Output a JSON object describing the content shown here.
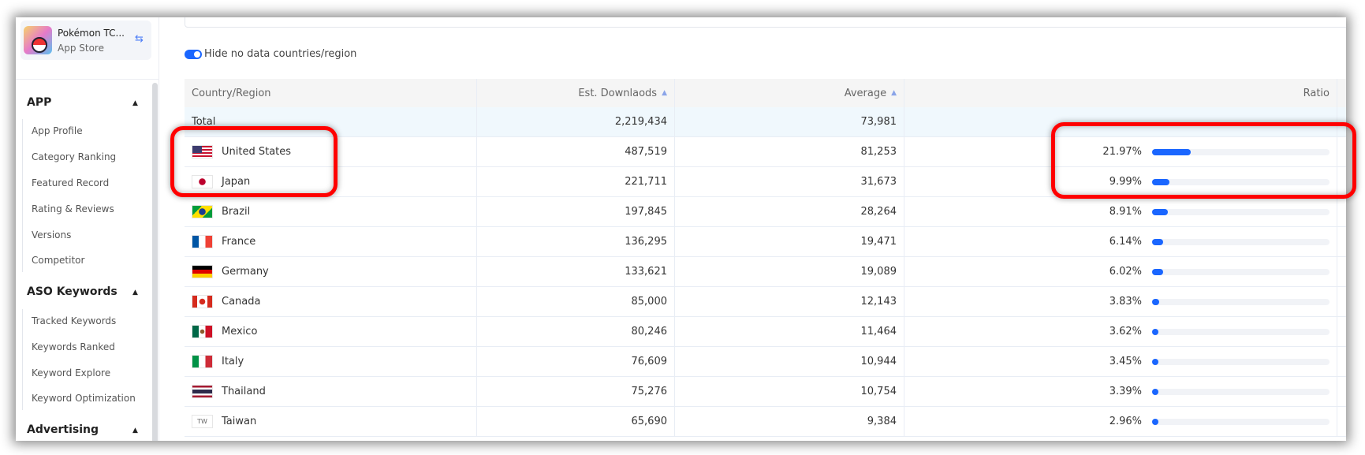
{
  "app": {
    "name": "Pokémon TC...",
    "store": "App Store"
  },
  "sidebar": {
    "sections": [
      {
        "label": "APP",
        "items": [
          "App Profile",
          "Category Ranking",
          "Featured Record",
          "Rating & Reviews",
          "Versions",
          "Competitor"
        ]
      },
      {
        "label": "ASO Keywords",
        "items": [
          "Tracked Keywords",
          "Keywords Ranked",
          "Keyword Explore",
          "Keyword Optimization"
        ]
      },
      {
        "label": "Advertising",
        "items": []
      }
    ]
  },
  "toggle": {
    "label": "Hide no data countries/region",
    "on": true
  },
  "table": {
    "headers": [
      "Country/Region",
      "Est. Downlaods",
      "Average",
      "Ratio"
    ],
    "total": {
      "label": "Total",
      "downloads": "2,219,434",
      "average": "73,981"
    },
    "rows": [
      {
        "country": "United States",
        "flag": "us",
        "downloads": "487,519",
        "average": "81,253",
        "ratio": "21.97%",
        "ratio_value": 21.97,
        "highlighted": true
      },
      {
        "country": "Japan",
        "flag": "jp",
        "downloads": "221,711",
        "average": "31,673",
        "ratio": "9.99%",
        "ratio_value": 9.99,
        "highlighted": true
      },
      {
        "country": "Brazil",
        "flag": "br",
        "downloads": "197,845",
        "average": "28,264",
        "ratio": "8.91%",
        "ratio_value": 8.91
      },
      {
        "country": "France",
        "flag": "fr",
        "downloads": "136,295",
        "average": "19,471",
        "ratio": "6.14%",
        "ratio_value": 6.14
      },
      {
        "country": "Germany",
        "flag": "de",
        "downloads": "133,621",
        "average": "19,089",
        "ratio": "6.02%",
        "ratio_value": 6.02
      },
      {
        "country": "Canada",
        "flag": "ca",
        "downloads": "85,000",
        "average": "12,143",
        "ratio": "3.83%",
        "ratio_value": 3.83
      },
      {
        "country": "Mexico",
        "flag": "mx",
        "downloads": "80,246",
        "average": "11,464",
        "ratio": "3.62%",
        "ratio_value": 3.62
      },
      {
        "country": "Italy",
        "flag": "it",
        "downloads": "76,609",
        "average": "10,944",
        "ratio": "3.45%",
        "ratio_value": 3.45
      },
      {
        "country": "Thailand",
        "flag": "th",
        "downloads": "75,276",
        "average": "10,754",
        "ratio": "3.39%",
        "ratio_value": 3.39
      },
      {
        "country": "Taiwan",
        "flag": "tw",
        "flag_text": "TW",
        "downloads": "65,690",
        "average": "9,384",
        "ratio": "2.96%",
        "ratio_value": 2.96
      }
    ]
  },
  "colors": {
    "accent": "#1a66ff",
    "highlight": "#ff0000"
  }
}
